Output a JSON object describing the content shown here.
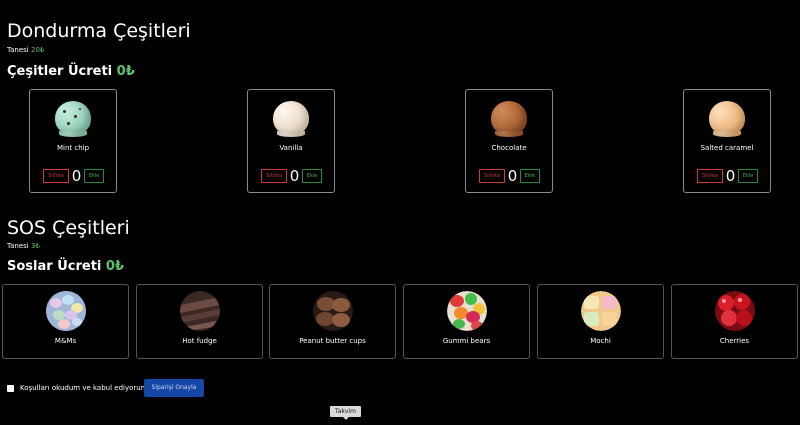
{
  "icecream": {
    "title": "Dondurma Çeşitleri",
    "unit_label": "Tanesi",
    "unit_price": "20₺",
    "total_label": "Çeşitler Ücreti",
    "total_value": "0₺",
    "delete_label": "Sil/nta",
    "add_label": "Ekle",
    "items": [
      {
        "name": "Mint chip",
        "qty": "0",
        "color": "#9fd7c1"
      },
      {
        "name": "Vanilla",
        "qty": "0",
        "color": "#f1e3d2"
      },
      {
        "name": "Chocolate",
        "qty": "0",
        "color": "#b86b3d"
      },
      {
        "name": "Salted caramel",
        "qty": "0",
        "color": "#f2bf8b"
      }
    ]
  },
  "sauces": {
    "title": "SOS Çeşitleri",
    "unit_label": "Tanesi",
    "unit_price": "3₺",
    "total_label": "Soslar Ücreti",
    "total_value": "0₺",
    "items": [
      {
        "name": "M&Ms",
        "icon": "mms-icon"
      },
      {
        "name": "Hot fudge",
        "icon": "hot-fudge-icon"
      },
      {
        "name": "Peanut butter cups",
        "icon": "peanut-butter-cups-icon"
      },
      {
        "name": "Gummi bears",
        "icon": "gummi-bears-icon"
      },
      {
        "name": "Mochi",
        "icon": "mochi-icon"
      },
      {
        "name": "Cherries",
        "icon": "cherries-icon"
      }
    ]
  },
  "terms_label": "Koşulları okudum ve kabul ediyorum",
  "confirm_label": "Siparişi Onayla",
  "tooltip": "Takvim"
}
